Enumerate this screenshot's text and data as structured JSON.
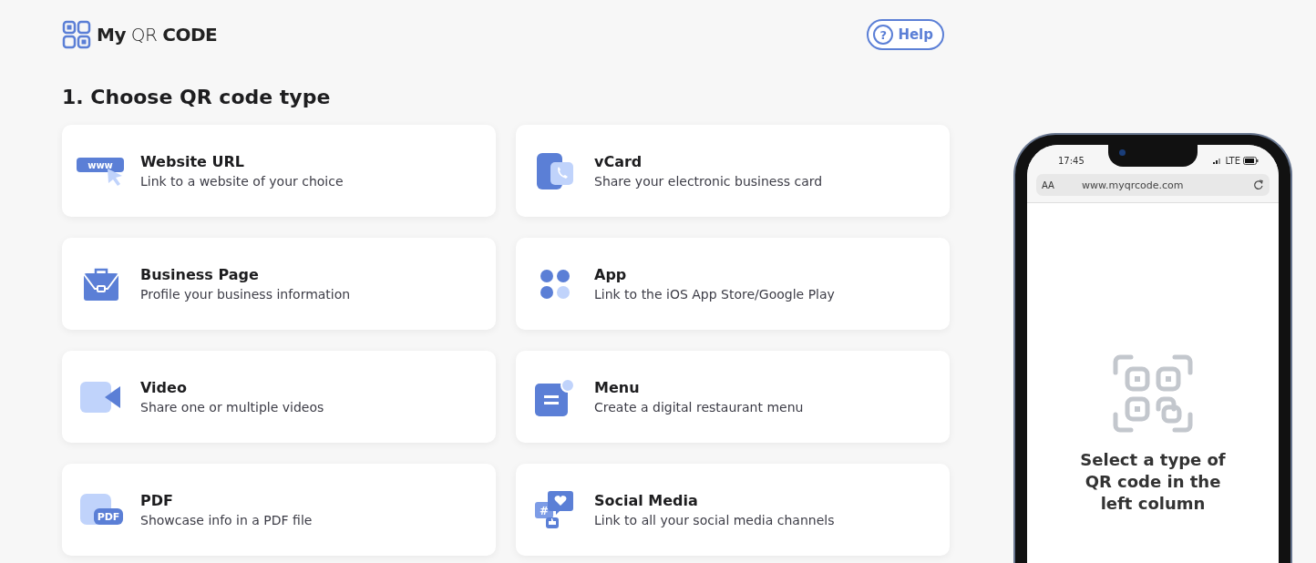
{
  "logo": {
    "text": "**My** QR **CODE**"
  },
  "help_button": {
    "icon": "?",
    "label": "Help"
  },
  "heading": "1. Choose QR code type",
  "types": [
    {
      "kind": "website",
      "title": "Website URL",
      "description": "Link to a website of your choice",
      "icon_text": "www"
    },
    {
      "kind": "vcard",
      "title": "vCard",
      "description": "Share your electronic business card"
    },
    {
      "kind": "business",
      "title": "Business Page",
      "description": "Profile your business information"
    },
    {
      "kind": "app",
      "title": "App",
      "description": "Link to the iOS App Store/Google Play"
    },
    {
      "kind": "video",
      "title": "Video",
      "description": "Share one or multiple videos"
    },
    {
      "kind": "menu",
      "title": "Menu",
      "description": "Create a digital restaurant menu"
    },
    {
      "kind": "pdf",
      "title": "PDF",
      "description": "Showcase info in a PDF file",
      "icon_text": "PDF"
    },
    {
      "kind": "social",
      "title": "Social Media",
      "description": "Link to all your social media channels",
      "icon_text": "#"
    }
  ],
  "phone": {
    "time": "17:45",
    "network": "LTE",
    "text_size": "AA",
    "url": "www.myqrcode.com",
    "prompt": "Select a type of QR code in the left column"
  }
}
